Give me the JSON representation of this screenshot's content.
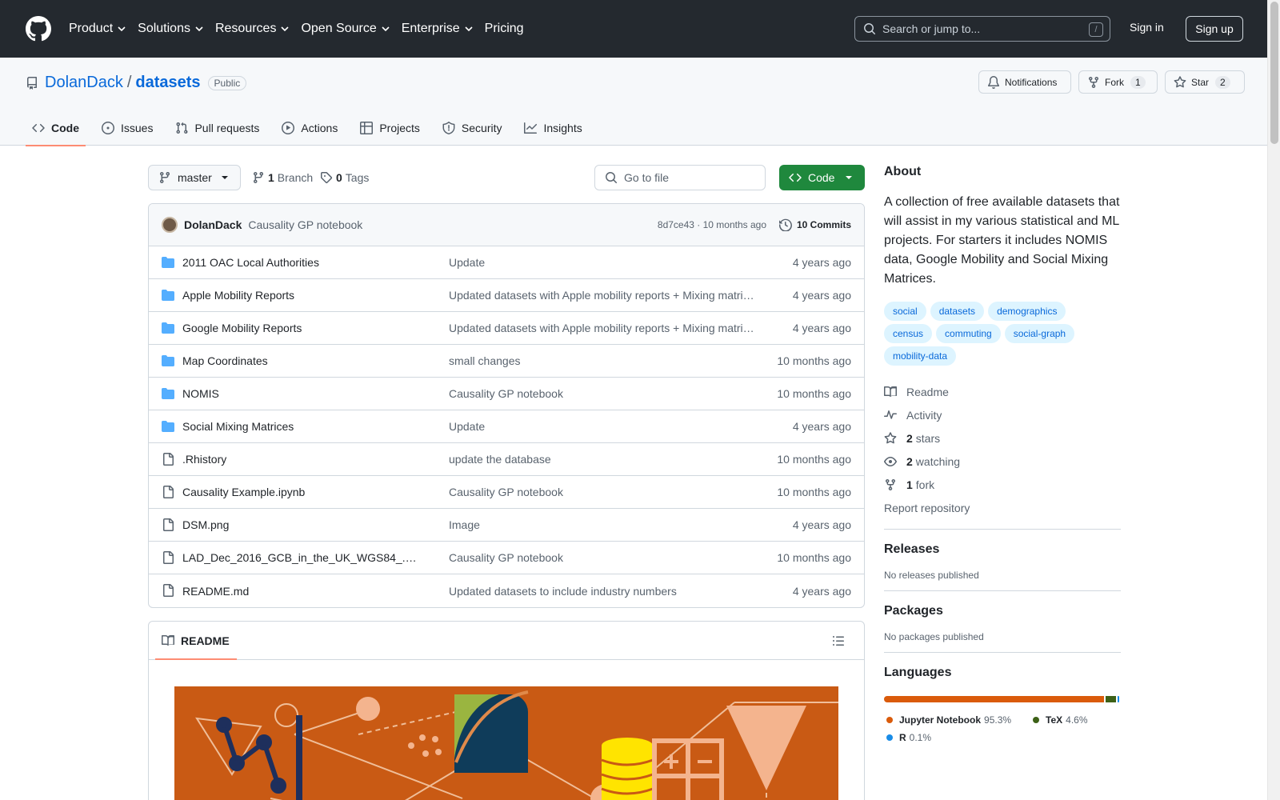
{
  "header": {
    "nav": [
      "Product",
      "Solutions",
      "Resources",
      "Open Source",
      "Enterprise",
      "Pricing"
    ],
    "search_placeholder": "Search or jump to...",
    "search_shortcut": "/",
    "signin": "Sign in",
    "signup": "Sign up"
  },
  "repo": {
    "owner": "DolanDack",
    "separator": "/",
    "name": "datasets",
    "visibility": "Public",
    "notifications_label": "Notifications",
    "fork_label": "Fork",
    "fork_count": "1",
    "star_label": "Star",
    "star_count": "2",
    "tabs": [
      {
        "label": "Code",
        "icon": "code-icon",
        "active": true
      },
      {
        "label": "Issues",
        "icon": "issue-icon"
      },
      {
        "label": "Pull requests",
        "icon": "pull-request-icon"
      },
      {
        "label": "Actions",
        "icon": "play-icon"
      },
      {
        "label": "Projects",
        "icon": "table-icon"
      },
      {
        "label": "Security",
        "icon": "shield-icon"
      },
      {
        "label": "Insights",
        "icon": "graph-icon"
      }
    ]
  },
  "toolbar": {
    "branch": "master",
    "branch_count": "1",
    "branch_label": "Branch",
    "tag_count": "0",
    "tag_label": "Tags",
    "go_to_file": "Go to file",
    "code_button": "Code"
  },
  "commit": {
    "author": "DolanDack",
    "message": "Causality GP notebook",
    "hash_time": "8d7ce43 · 10 months ago",
    "commits_label": "10 Commits"
  },
  "files": [
    {
      "type": "folder",
      "name": "2011 OAC Local Authorities",
      "message": "Update",
      "age": "4 years ago"
    },
    {
      "type": "folder",
      "name": "Apple Mobility Reports",
      "message": "Updated datasets with Apple mobility reports + Mixing matri…",
      "age": "4 years ago"
    },
    {
      "type": "folder",
      "name": "Google Mobility Reports",
      "message": "Updated datasets with Apple mobility reports + Mixing matri…",
      "age": "4 years ago"
    },
    {
      "type": "folder",
      "name": "Map Coordinates",
      "message": "small changes",
      "age": "10 months ago"
    },
    {
      "type": "folder",
      "name": "NOMIS",
      "message": "Causality GP notebook",
      "age": "10 months ago"
    },
    {
      "type": "folder",
      "name": "Social Mixing Matrices",
      "message": "Update",
      "age": "4 years ago"
    },
    {
      "type": "file",
      "name": ".Rhistory",
      "message": "update the database",
      "age": "10 months ago"
    },
    {
      "type": "file",
      "name": "Causality Example.ipynb",
      "message": "Causality GP notebook",
      "age": "10 months ago"
    },
    {
      "type": "file",
      "name": "DSM.png",
      "message": "Image",
      "age": "4 years ago"
    },
    {
      "type": "file",
      "name": "LAD_Dec_2016_GCB_in_the_UK_WGS84_.…",
      "message": "Causality GP notebook",
      "age": "10 months ago"
    },
    {
      "type": "file",
      "name": "README.md",
      "message": "Updated datasets to include industry numbers",
      "age": "4 years ago"
    }
  ],
  "readme": {
    "title": "README"
  },
  "about": {
    "title": "About",
    "description": "A collection of free available datasets that will assist in my various statistical and ML projects. For starters it includes NOMIS data, Google Mobility and Social Mixing Matrices.",
    "topics": [
      "social",
      "datasets",
      "demographics",
      "census",
      "commuting",
      "social-graph",
      "mobility-data"
    ],
    "links": [
      {
        "icon": "book-icon",
        "count": "",
        "label": "Readme"
      },
      {
        "icon": "pulse-icon",
        "count": "",
        "label": "Activity"
      },
      {
        "icon": "star-icon",
        "count": "2",
        "label": "stars"
      },
      {
        "icon": "eye-icon",
        "count": "2",
        "label": "watching"
      },
      {
        "icon": "fork-icon",
        "count": "1",
        "label": "fork"
      }
    ],
    "report": "Report repository"
  },
  "releases": {
    "title": "Releases",
    "empty": "No releases published"
  },
  "packages": {
    "title": "Packages",
    "empty": "No packages published"
  },
  "languages": {
    "title": "Languages",
    "items": [
      {
        "name": "Jupyter Notebook",
        "percent": "95.3%",
        "value": 95.3,
        "color": "#DA5B0B"
      },
      {
        "name": "TeX",
        "percent": "4.6%",
        "value": 4.6,
        "color": "#3D6117"
      },
      {
        "name": "R",
        "percent": "0.1%",
        "value": 0.1,
        "color": "#198CE7"
      }
    ]
  }
}
